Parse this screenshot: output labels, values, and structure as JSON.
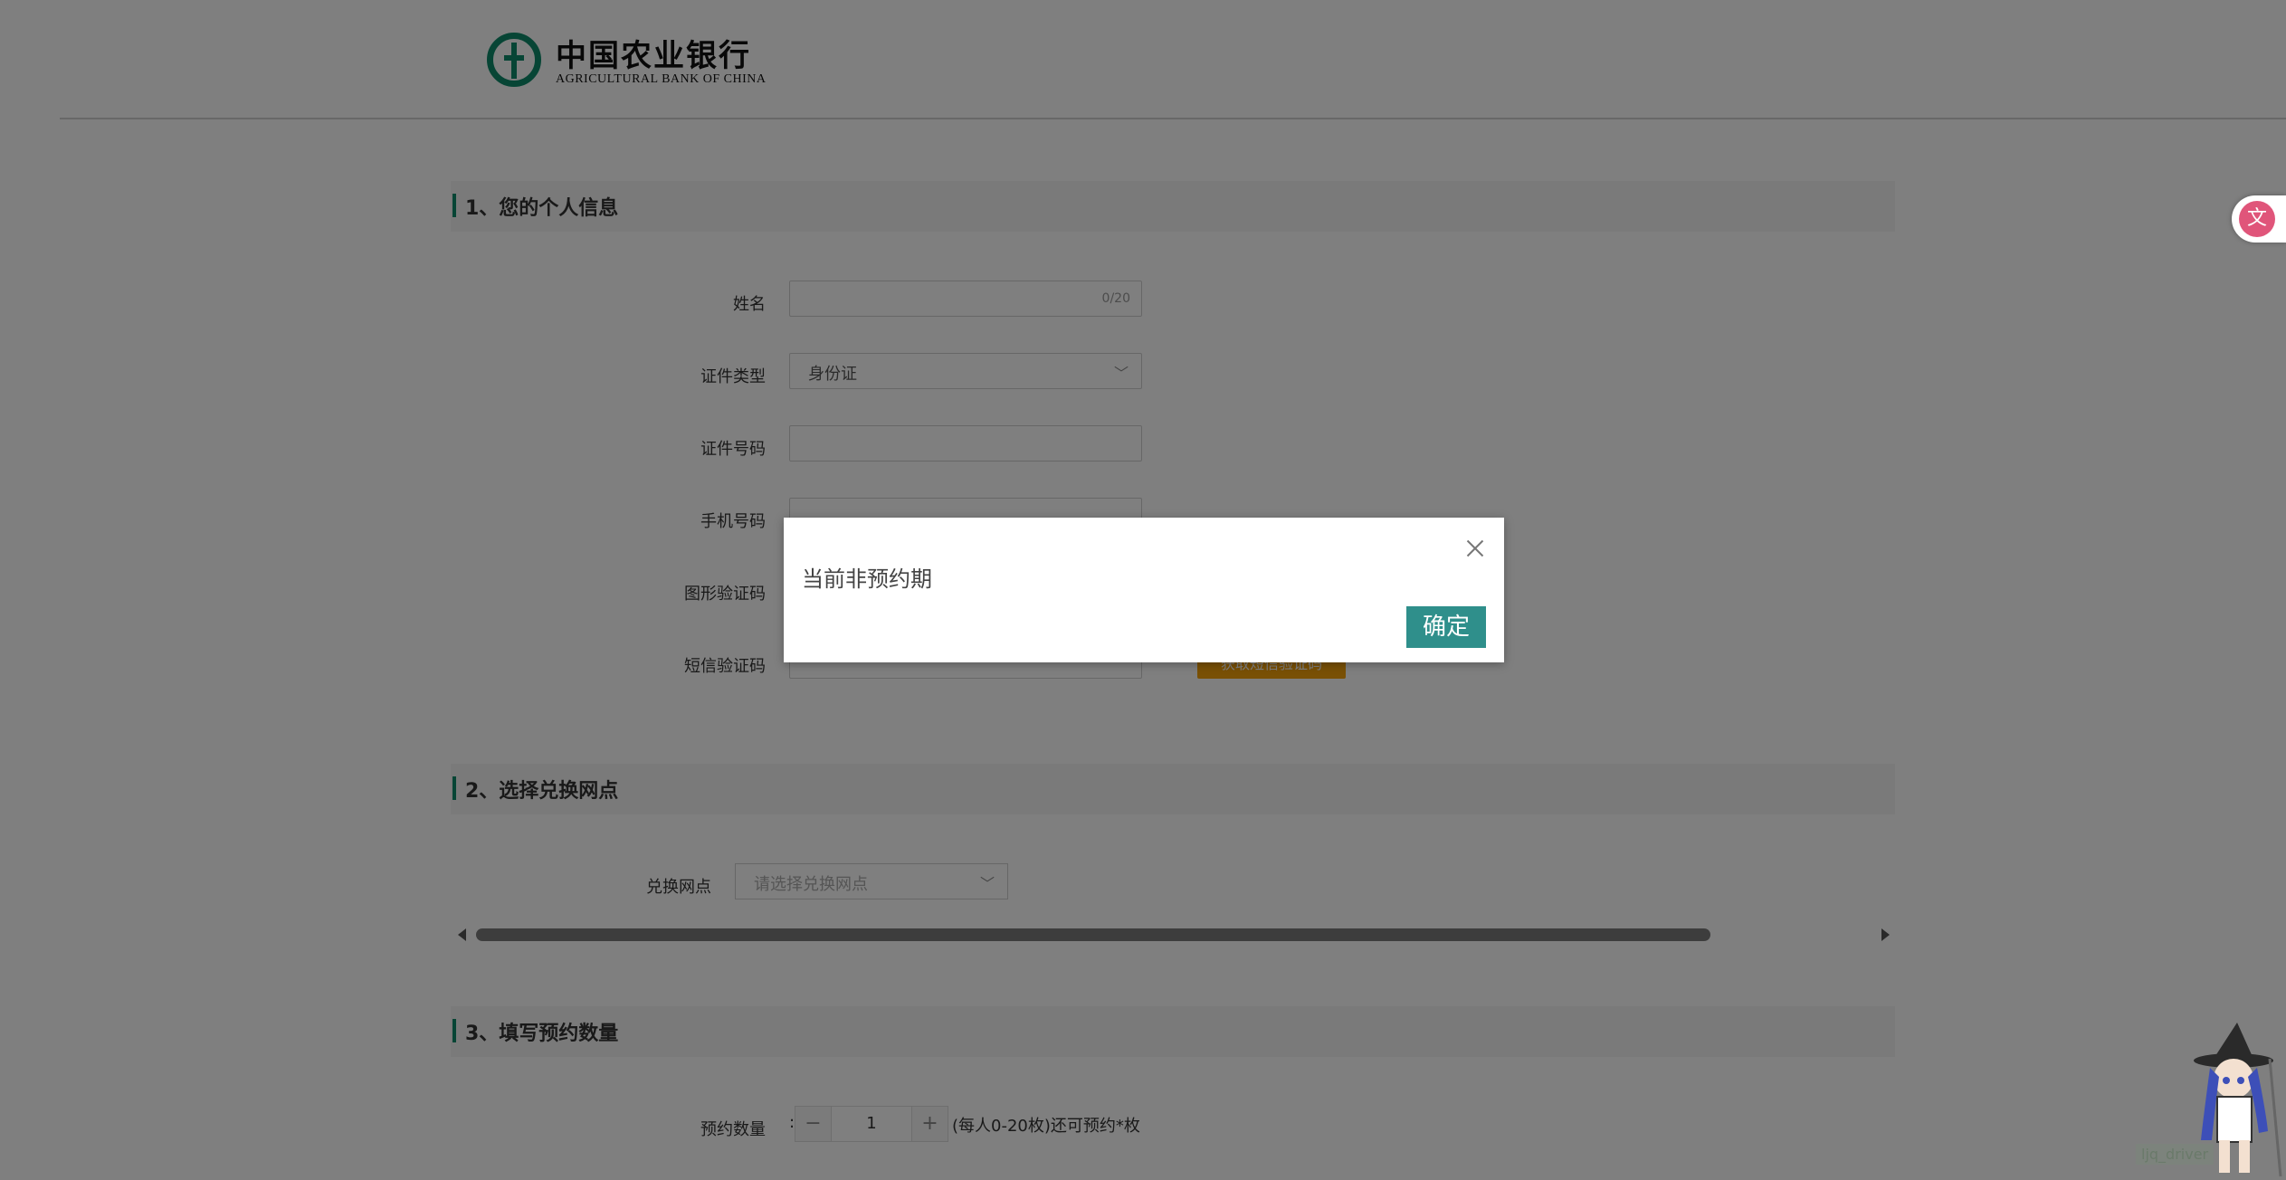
{
  "header": {
    "logo_cn": "中国农业银行",
    "logo_en": "AGRICULTURAL BANK OF CHINA"
  },
  "section1": {
    "title": "1、您的个人信息",
    "name_label": "姓名",
    "name_counter": "0/20",
    "id_type_label": "证件类型",
    "id_type_value": "身份证",
    "id_number_label": "证件号码",
    "phone_label": "手机号码",
    "captcha_label": "图形验证码",
    "sms_label": "短信验证码",
    "sms_button": "获取短信验证码"
  },
  "section2": {
    "title": "2、选择兑换网点",
    "branch_label": "兑换网点",
    "branch_placeholder": "请选择兑换网点"
  },
  "section3": {
    "title": "3、填写预约数量",
    "qty_label": "预约数量",
    "qty_colon": ":",
    "qty_minus": "−",
    "qty_value": "1",
    "qty_plus": "+",
    "qty_note": "(每人0-20枚)还可预约*枚"
  },
  "dialog": {
    "message": "当前非预约期",
    "ok_label": "确定"
  },
  "extras": {
    "translate_icon": "translate-icon",
    "watermark": "ljq_driver"
  },
  "colors": {
    "brand": "#0e8a6b",
    "dialog_button": "#2f8f8b",
    "sms_button": "#f3a00b"
  }
}
